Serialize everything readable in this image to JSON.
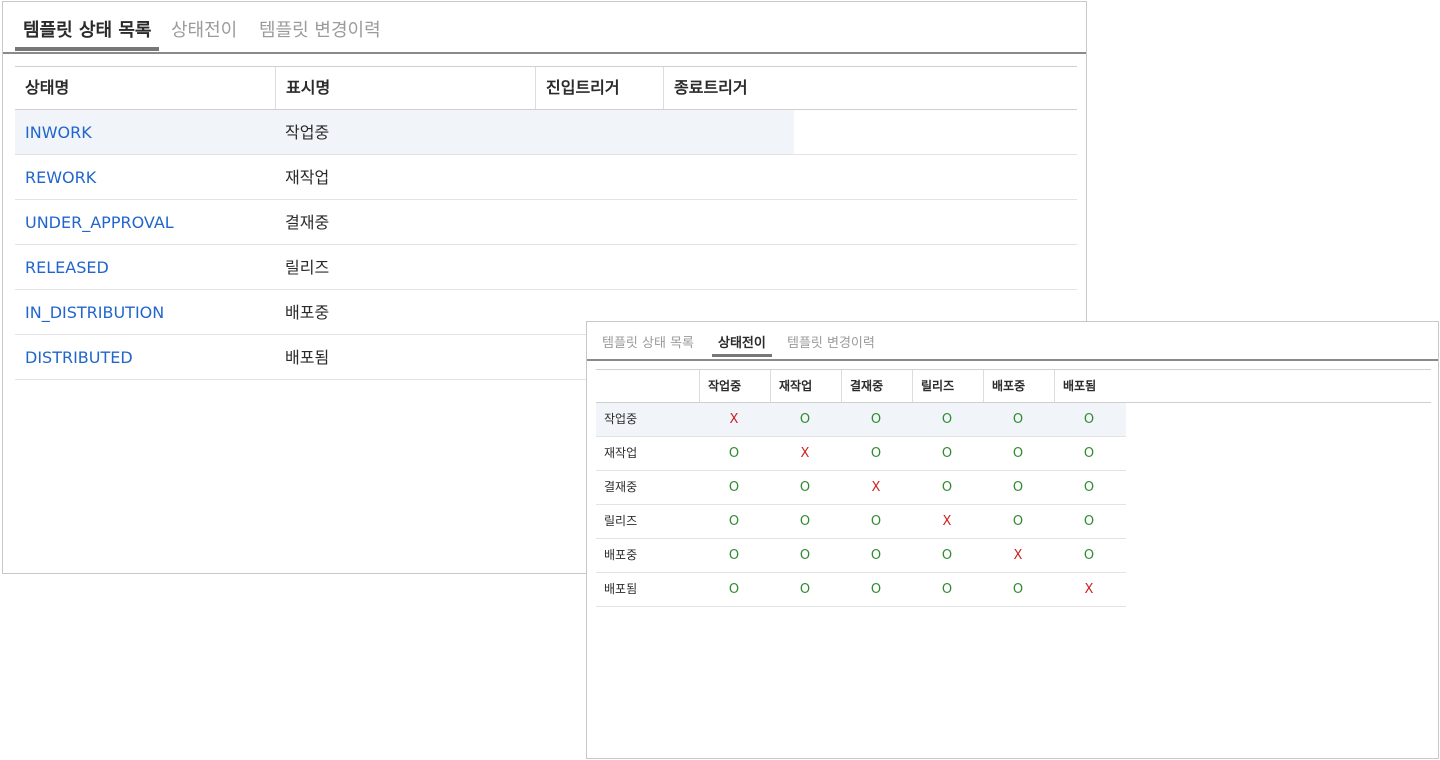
{
  "panel1": {
    "tabs": [
      {
        "label": "템플릿 상태 목록",
        "active": true
      },
      {
        "label": "상태전이",
        "active": false
      },
      {
        "label": "템플릿 변경이력",
        "active": false
      }
    ],
    "columns": [
      "상태명",
      "표시명",
      "진입트리거",
      "종료트리거"
    ],
    "rows": [
      {
        "name": "INWORK",
        "display": "작업중"
      },
      {
        "name": "REWORK",
        "display": "재작업"
      },
      {
        "name": "UNDER_APPROVAL",
        "display": "결재중"
      },
      {
        "name": "RELEASED",
        "display": "릴리즈"
      },
      {
        "name": "IN_DISTRIBUTION",
        "display": "배포중"
      },
      {
        "name": "DISTRIBUTED",
        "display": "배포됨"
      }
    ],
    "selected_row": 0
  },
  "panel2": {
    "tabs": [
      {
        "label": "템플릿 상태 목록",
        "active": false
      },
      {
        "label": "상태전이",
        "active": true
      },
      {
        "label": "템플릿 변경이력",
        "active": false
      }
    ],
    "columns": [
      "",
      "작업중",
      "재작업",
      "결재중",
      "릴리즈",
      "배포중",
      "배포됨"
    ],
    "rows": [
      {
        "label": "작업중",
        "marks": [
          "X",
          "O",
          "O",
          "O",
          "O",
          "O"
        ]
      },
      {
        "label": "재작업",
        "marks": [
          "O",
          "X",
          "O",
          "O",
          "O",
          "O"
        ]
      },
      {
        "label": "결재중",
        "marks": [
          "O",
          "O",
          "X",
          "O",
          "O",
          "O"
        ]
      },
      {
        "label": "릴리즈",
        "marks": [
          "O",
          "O",
          "O",
          "X",
          "O",
          "O"
        ]
      },
      {
        "label": "배포중",
        "marks": [
          "O",
          "O",
          "O",
          "O",
          "X",
          "O"
        ]
      },
      {
        "label": "배포됨",
        "marks": [
          "O",
          "O",
          "O",
          "O",
          "O",
          "X"
        ]
      }
    ],
    "selected_row": 0
  },
  "colors": {
    "link": "#2266cc",
    "allowed": "#2e8b2e",
    "denied": "#cc2222",
    "selected_row_bg": "#f1f5fa"
  }
}
